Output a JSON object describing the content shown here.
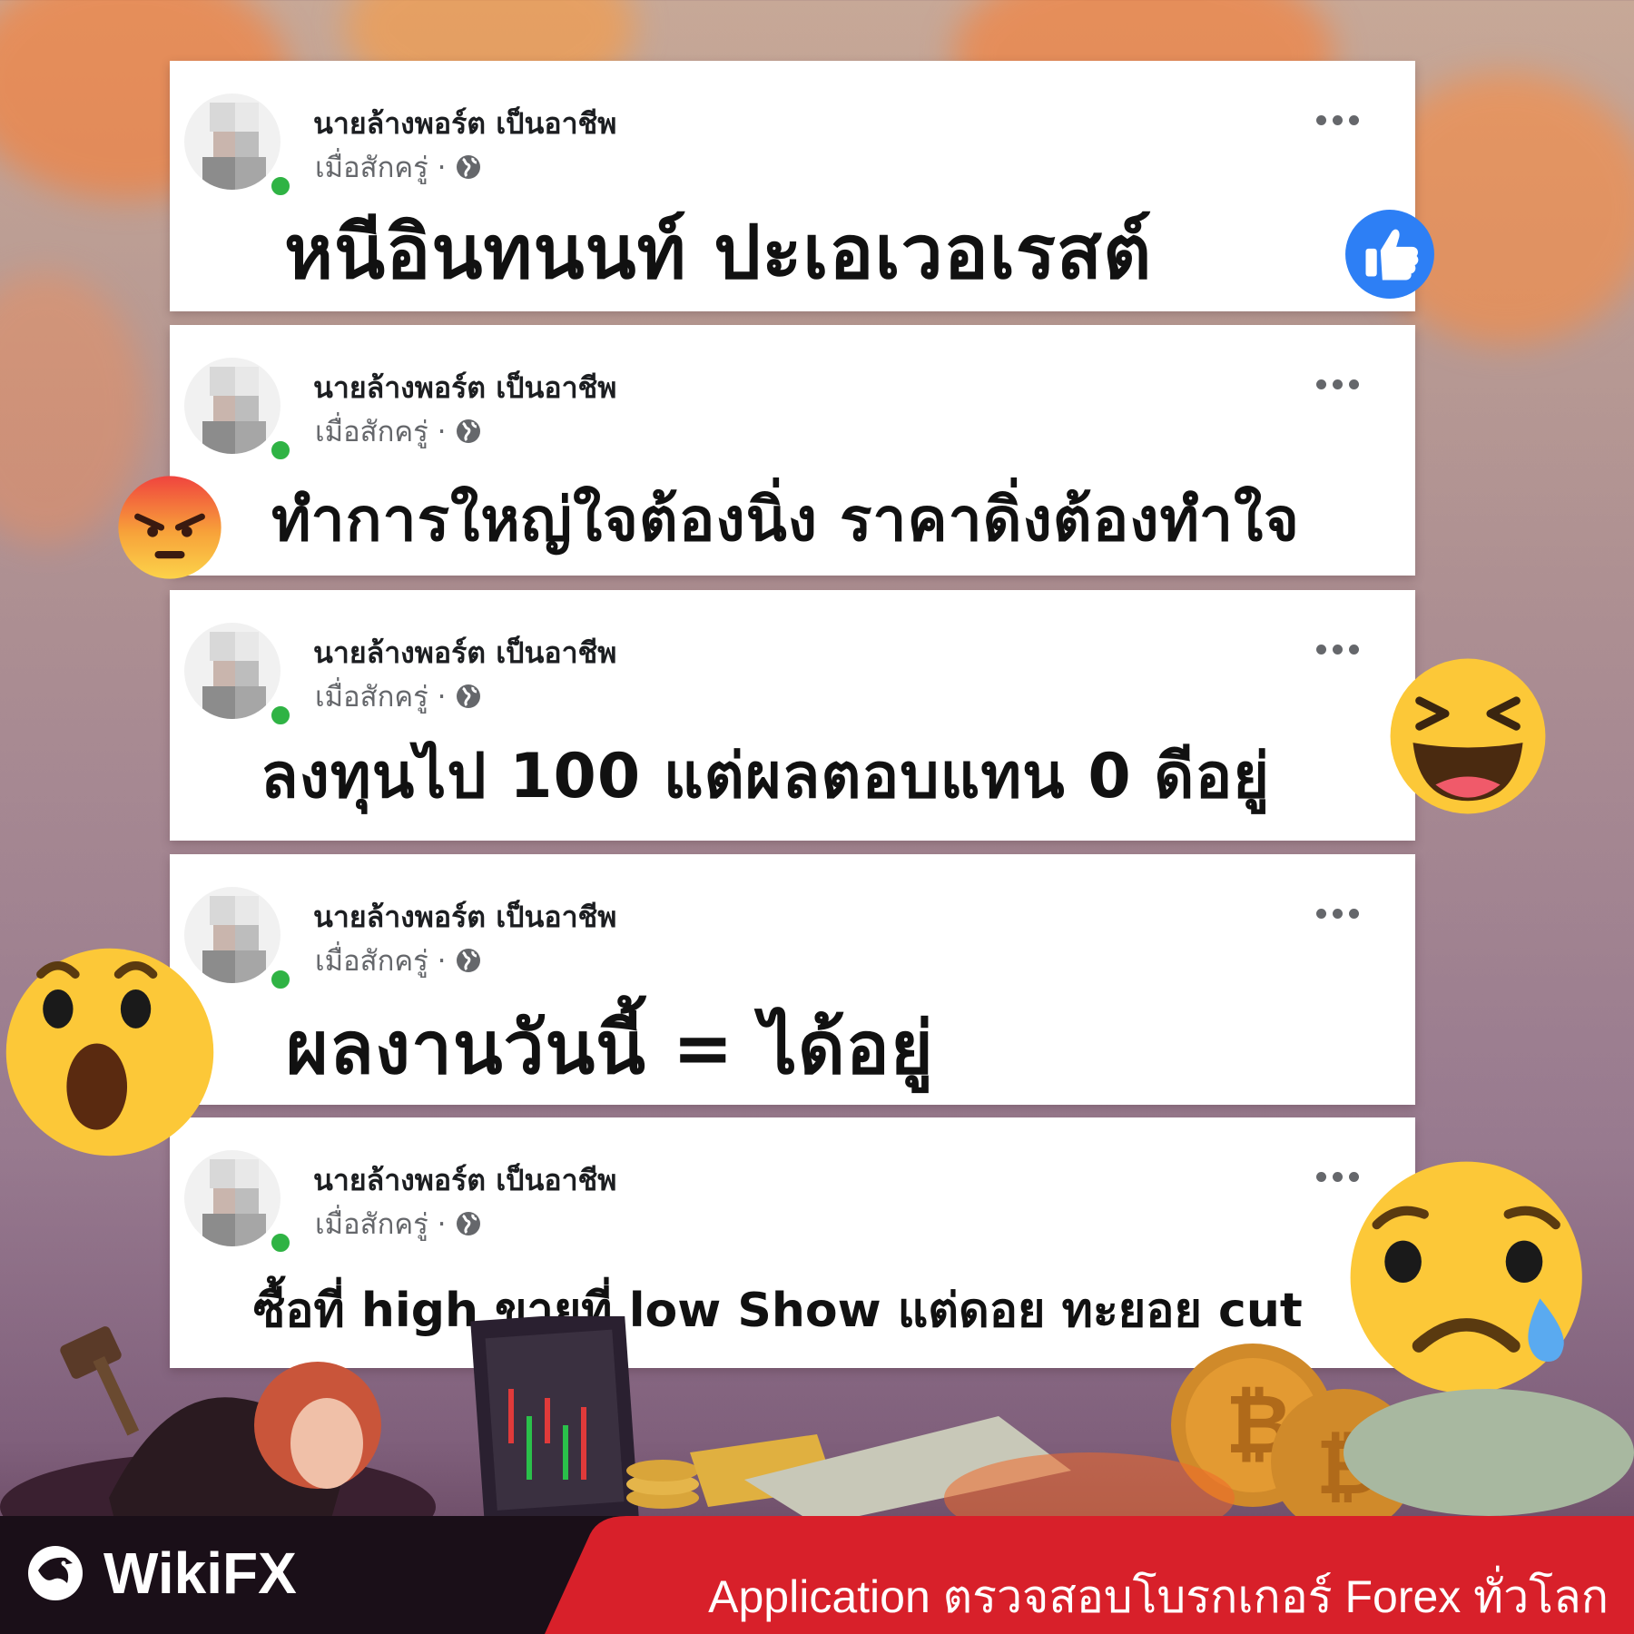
{
  "posts": [
    {
      "username": "นายล้างพอร์ต เป็นอาชีพ",
      "time": "เมื่อสักครู่ ·",
      "text": "หนีอินทนนท์ ปะเอเวอเรสต์",
      "reaction": "like-icon"
    },
    {
      "username": "นายล้างพอร์ต เป็นอาชีพ",
      "time": "เมื่อสักครู่ ·",
      "text": "ทำการใหญ่ใจต้องนิ่ง ราคาดิ่งต้องทำใจ",
      "reaction": "angry-emoji"
    },
    {
      "username": "นายล้างพอร์ต เป็นอาชีพ",
      "time": "เมื่อสักครู่ ·",
      "text": "ลงทุนไป 100 แต่ผลตอบแทน 0 ดีอยู่",
      "reaction": "haha-emoji"
    },
    {
      "username": "นายล้างพอร์ต เป็นอาชีพ",
      "time": "เมื่อสักครู่ ·",
      "text": "ผลงานวันนี้ = ได้อยู่",
      "reaction": "wow-emoji"
    },
    {
      "username": "นายล้างพอร์ต เป็นอาชีพ",
      "time": "เมื่อสักครู่ ·",
      "text": "ซื้อที่ high ขายที่ low Show แต่ดอย ทะยอย cut",
      "reaction": "sad-emoji"
    }
  ],
  "brand": {
    "name": "WikiFX",
    "tagline": "Application ตรวจสอบโบรกเกอร์ Forex ทั่วโลก"
  },
  "colors": {
    "accent_red": "#d8202a",
    "online": "#2fb344",
    "like_blue": "#1877f2"
  }
}
